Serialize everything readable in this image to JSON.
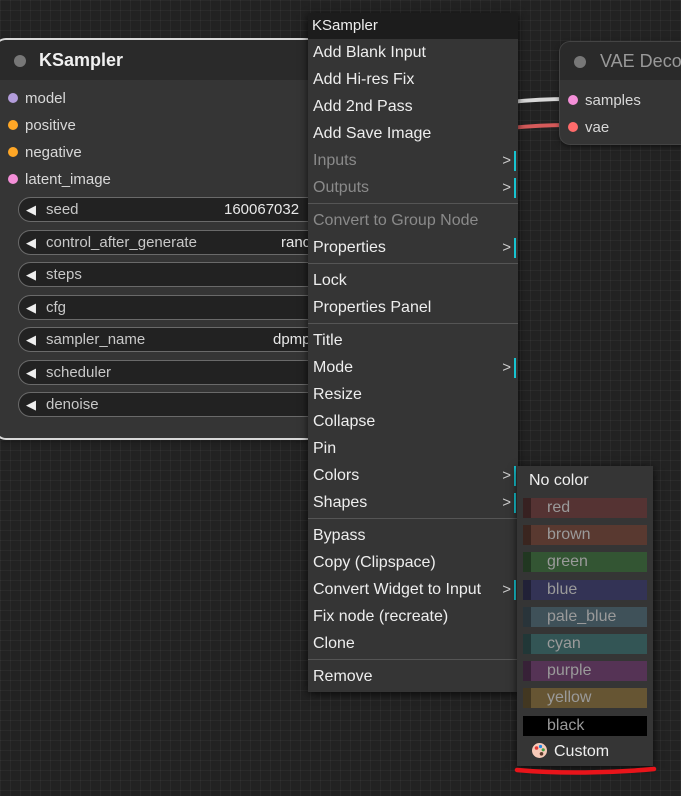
{
  "ksampler": {
    "title": "KSampler",
    "inputs": [
      {
        "label": "model",
        "color": "#b39ddb"
      },
      {
        "label": "positive",
        "color": "#ffa726"
      },
      {
        "label": "negative",
        "color": "#ffa726"
      },
      {
        "label": "latent_image",
        "color": "#f48fd8"
      }
    ],
    "widgets": [
      {
        "name": "seed",
        "value": "160067032"
      },
      {
        "name": "control_after_generate",
        "value": "ranc"
      },
      {
        "name": "steps",
        "value": ""
      },
      {
        "name": "cfg",
        "value": ""
      },
      {
        "name": "sampler_name",
        "value": "dpmp"
      },
      {
        "name": "scheduler",
        "value": ""
      },
      {
        "name": "denoise",
        "value": ""
      }
    ]
  },
  "vae_node": {
    "title": "VAE Deco",
    "inputs": [
      {
        "label": "samples",
        "color": "#f48fd8"
      },
      {
        "label": "vae",
        "color": "#ff6b6b"
      }
    ]
  },
  "context_menu": {
    "title": "KSampler",
    "items": [
      {
        "label": "Add Blank Input"
      },
      {
        "label": "Add Hi-res Fix"
      },
      {
        "label": "Add 2nd Pass"
      },
      {
        "label": "Add Save Image"
      },
      {
        "label": "Inputs",
        "submenu": true,
        "disabled": true
      },
      {
        "label": "Outputs",
        "submenu": true,
        "disabled": true
      },
      {
        "label": "Convert to Group Node",
        "disabled": true,
        "separator_before": true
      },
      {
        "label": "Properties",
        "submenu": true
      },
      {
        "label": "Lock",
        "separator_before": true
      },
      {
        "label": "Properties Panel"
      },
      {
        "label": "Title",
        "separator_before": true
      },
      {
        "label": "Mode",
        "submenu": true
      },
      {
        "label": "Resize"
      },
      {
        "label": "Collapse"
      },
      {
        "label": "Pin"
      },
      {
        "label": "Colors",
        "submenu": true
      },
      {
        "label": "Shapes",
        "submenu": true
      },
      {
        "label": "Bypass",
        "separator_before": true
      },
      {
        "label": "Copy (Clipspace)"
      },
      {
        "label": "Convert Widget to Input",
        "submenu": true
      },
      {
        "label": "Fix node (recreate)"
      },
      {
        "label": "Clone"
      },
      {
        "label": "Remove",
        "separator_before": true
      }
    ],
    "submenu_glyph": ">"
  },
  "colors_menu": {
    "no_color": "No color",
    "colors": [
      {
        "label": "red",
        "color": "#553333"
      },
      {
        "label": "brown",
        "color": "#593930"
      },
      {
        "label": "green",
        "color": "#335533"
      },
      {
        "label": "blue",
        "color": "#333355"
      },
      {
        "label": "pale_blue",
        "color": "#3f5159"
      },
      {
        "label": "cyan",
        "color": "#335555"
      },
      {
        "label": "purple",
        "color": "#553355"
      },
      {
        "label": "yellow",
        "color": "#665533"
      },
      {
        "label": "black",
        "color": "#000000"
      }
    ],
    "custom": "Custom"
  },
  "highlight_color": "#e8141a",
  "accent_color": "#17c3d0"
}
